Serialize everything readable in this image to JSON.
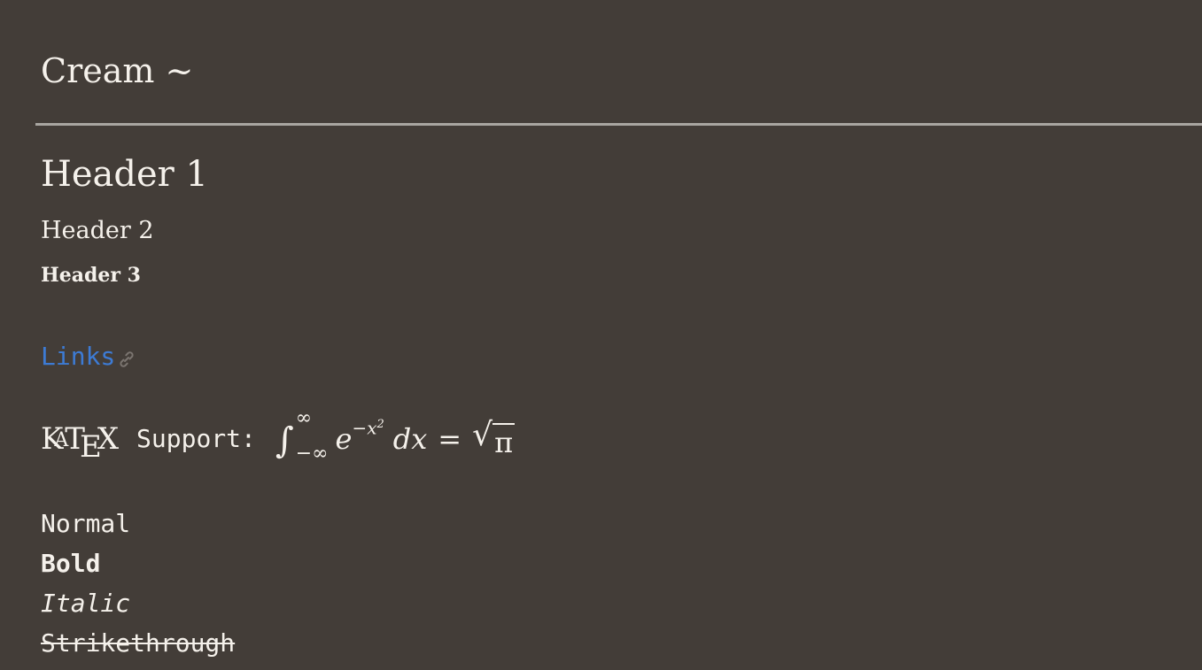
{
  "theme": {
    "title": "Cream ~",
    "background": "#433d38",
    "text_color": "#f5f1eb",
    "link_color": "#3d7bd4",
    "rule_color": "#a9a6a1"
  },
  "headers": {
    "h1": "Header 1",
    "h2": "Header 2",
    "h3": "Header 3"
  },
  "link": {
    "text": "Links",
    "icon": "link-icon"
  },
  "katex": {
    "logo": {
      "k": "K",
      "a": "A",
      "t": "T",
      "e": "E",
      "x": "X"
    },
    "label": "Support:",
    "formula": {
      "integral": "∫",
      "upper_limit": "∞",
      "lower_limit": "−∞",
      "base": "e",
      "exponent": "−x",
      "exponent_power": "2",
      "differential": "dx",
      "equals": "=",
      "radical": "√",
      "radicand": "π"
    }
  },
  "text_styles": {
    "normal": "Normal",
    "bold": "Bold",
    "italic": "Italic",
    "strikethrough": "Strikethrough"
  }
}
